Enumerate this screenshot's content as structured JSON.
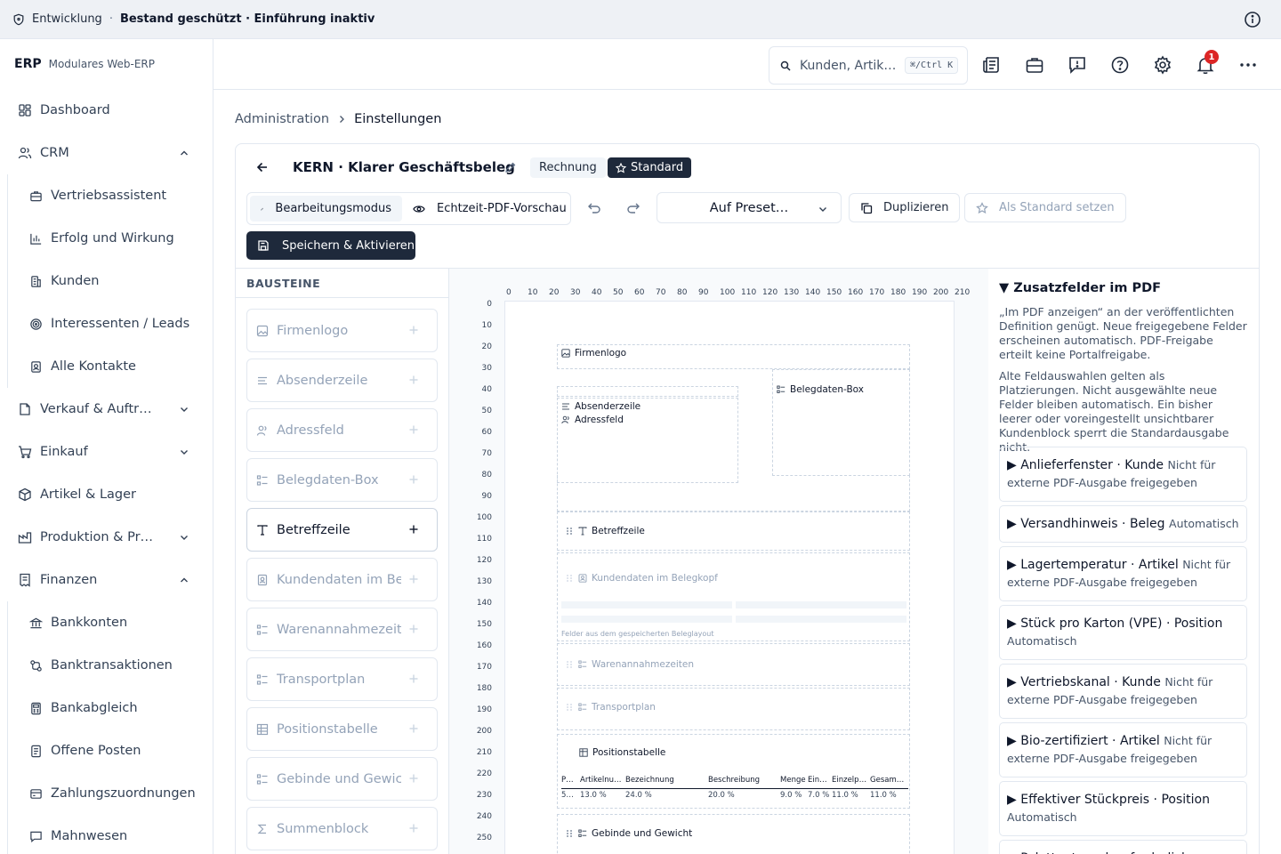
{
  "env": {
    "name": "Entwicklung",
    "separator": "·",
    "state": "Bestand geschützt · Einführung inaktiv"
  },
  "brand": {
    "logo": "ERP",
    "subtitle": "Modulares Web-ERP"
  },
  "nav": {
    "dashboard": "Dashboard",
    "crm": "CRM",
    "crm_items": [
      "Vertriebsassistent",
      "Erfolg und Wirkung",
      "Kunden",
      "Interessenten / Leads",
      "Alle Kontakte"
    ],
    "sales": "Verkauf & Auftr…",
    "purchase": "Einkauf",
    "stock": "Artikel & Lager",
    "production": "Produktion & Pr…",
    "finance": "Finanzen",
    "finance_items": [
      "Bankkonten",
      "Banktransaktionen",
      "Bankabgleich",
      "Offene Posten",
      "Zahlungszuordnungen",
      "Mahnwesen"
    ]
  },
  "header": {
    "search_placeholder": "Kunden, Artik…",
    "search_shortcut": "⌘/Ctrl K",
    "notification_count": "1"
  },
  "breadcrumb": {
    "parent": "Administration",
    "current": "Einstellungen"
  },
  "editor": {
    "title": "KERN · Klarer Geschäftsbeleg",
    "type_chip": "Rechnung",
    "standard_chip": "Standard",
    "mode_edit": "Bearbeitungsmodus",
    "mode_preview": "Echtzeit-PDF-Vorschau",
    "preset": "Auf Preset…",
    "duplicate": "Duplizieren",
    "set_default": "Als Standard setzen",
    "save": "Speichern & Aktivieren"
  },
  "blocks": {
    "heading": "BAUSTEINE",
    "items": [
      "Firmenlogo",
      "Absenderzeile",
      "Adressfeld",
      "Belegdaten-Box",
      "Betreffzeile",
      "Kundendaten im Belegkopf",
      "Warenannahmezeiten",
      "Transportplan",
      "Positionstabelle",
      "Gebinde und Gewicht",
      "Summenblock"
    ]
  },
  "canvas": {
    "x_ticks": [
      "0",
      "10",
      "20",
      "30",
      "40",
      "50",
      "60",
      "70",
      "80",
      "90",
      "100",
      "110",
      "120",
      "130",
      "140",
      "150",
      "160",
      "170",
      "180",
      "190",
      "200",
      "210"
    ],
    "y_ticks": [
      "0",
      "10",
      "20",
      "30",
      "40",
      "50",
      "60",
      "70",
      "80",
      "90",
      "100",
      "110",
      "120",
      "130",
      "140",
      "150",
      "160",
      "170",
      "180",
      "190",
      "200",
      "210",
      "220",
      "230",
      "240",
      "250"
    ],
    "logo": "Firmenlogo",
    "sender": "Absenderzeile",
    "address": "Adressfeld",
    "docbox": "Belegdaten-Box",
    "subject": "Betreffzeile",
    "customer": "Kundendaten im Belegkopf",
    "customer_note": "Felder aus dem gespeicherten Beleglayout",
    "receiving": "Warenannahmezeiten",
    "transport": "Transportplan",
    "positions": "Positionstabelle",
    "table_headers": [
      "P…",
      "Artikelnu…",
      "Bezeichnung",
      "Beschreibung",
      "Menge",
      "Ein…",
      "Einzelp…",
      "Gesam…"
    ],
    "table_values": [
      "5…",
      "13.0 %",
      "24.0 %",
      "20.0 %",
      "9.0 %",
      "7.0 %",
      "11.0 %",
      "11.0 %"
    ],
    "packaging": "Gebinde und Gewicht"
  },
  "fields": {
    "title": "Zusatzfelder im PDF",
    "p1": "„Im PDF anzeigen“ an der veröffentlichten Definition genügt. Neue freigegebene Felder erscheinen automatisch. PDF-Freigabe erteilt keine Portalfreigabe.",
    "p2": "Alte Feldauswahlen gelten als Platzierungen. Nicht ausgewählte neue Felder bleiben automatisch. Ein bisher leerer oder voreingestellt unsichtbarer Kundenblock sperrt die Standardausgabe nicht.",
    "items": [
      {
        "name": "Anlieferfenster · Kunde",
        "status": "Nicht für externe PDF-Ausgabe freigegeben"
      },
      {
        "name": "Versandhinweis · Beleg",
        "status": "Automatisch"
      },
      {
        "name": "Lagertemperatur · Artikel",
        "status": "Nicht für externe PDF-Ausgabe freigegeben"
      },
      {
        "name": "Stück pro Karton (VPE) · Position",
        "status": "Automatisch"
      },
      {
        "name": "Vertriebskanal · Kunde",
        "status": "Nicht für externe PDF-Ausgabe freigegeben"
      },
      {
        "name": "Bio-zertifiziert · Artikel",
        "status": "Nicht für externe PDF-Ausgabe freigegeben"
      },
      {
        "name": "Effektiver Stückpreis · Position",
        "status": "Automatisch"
      },
      {
        "name": "Palettentausch erforderlich",
        "status": ""
      }
    ]
  }
}
